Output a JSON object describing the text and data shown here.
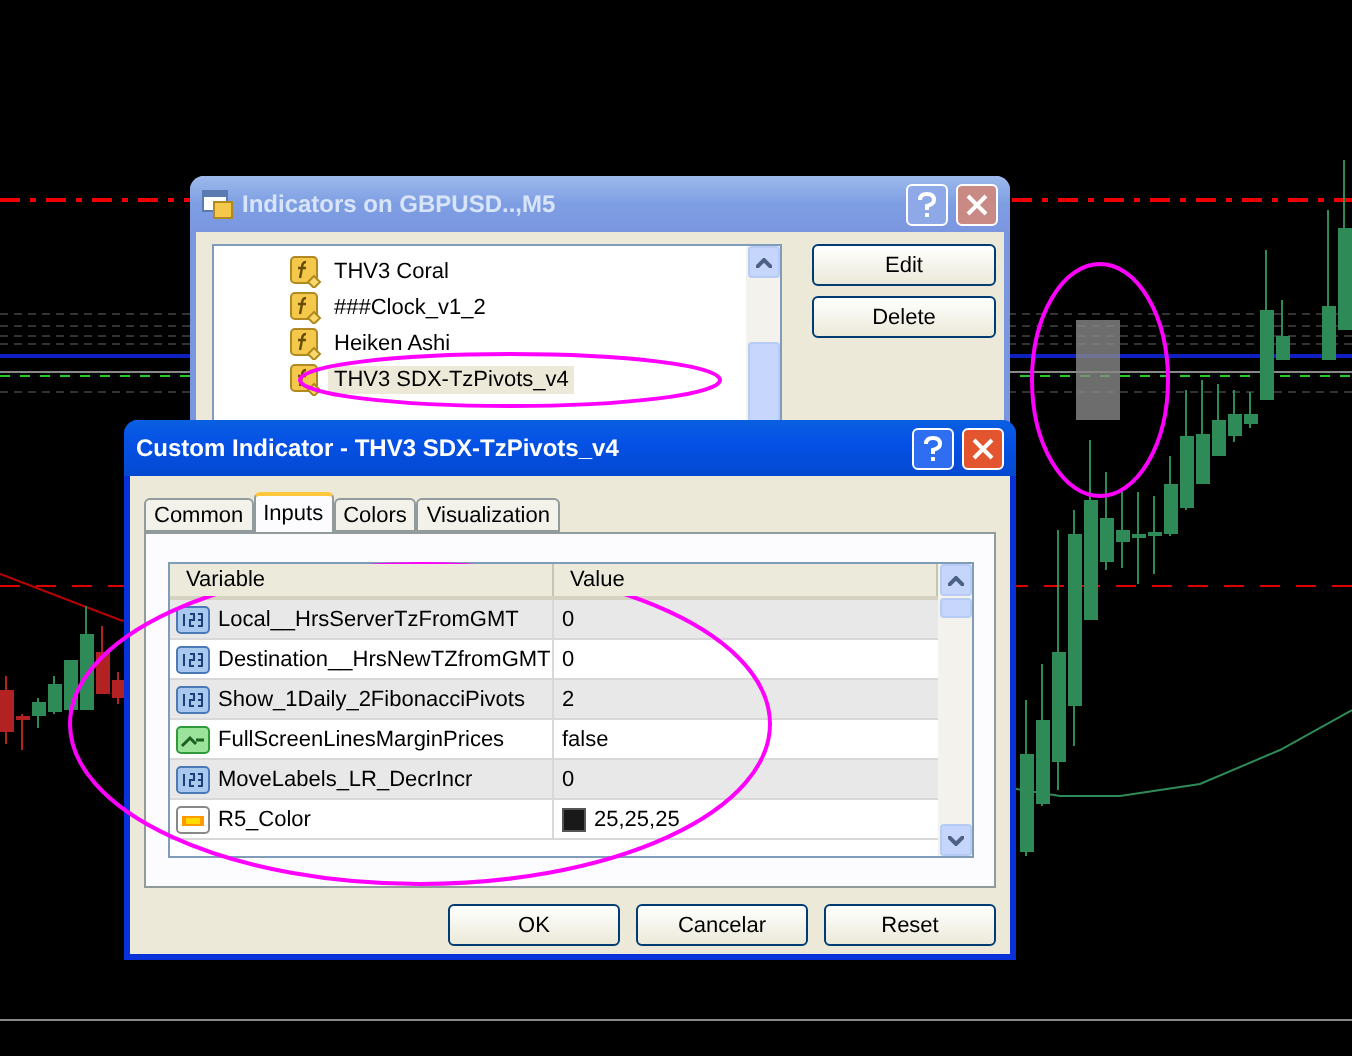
{
  "indicators_window": {
    "title": "Indicators on GBPUSD..,M5",
    "active": false,
    "tree": [
      {
        "label": "THV3 Coral",
        "selected": false
      },
      {
        "label": "###Clock_v1_2",
        "selected": false
      },
      {
        "label": "Heiken Ashi",
        "selected": false
      },
      {
        "label": "THV3 SDX-TzPivots_v4",
        "selected": true
      }
    ],
    "buttons": [
      "Edit",
      "Delete"
    ]
  },
  "custom_indicator_window": {
    "title": "Custom Indicator - THV3 SDX-TzPivots_v4",
    "active": true,
    "tabs": [
      {
        "label": "Common",
        "selected": false
      },
      {
        "label": "Inputs",
        "selected": true
      },
      {
        "label": "Colors",
        "selected": false
      },
      {
        "label": "Visualization",
        "selected": false
      }
    ],
    "table": {
      "columns": [
        "Variable",
        "Value"
      ],
      "rows": [
        {
          "kind": "number",
          "variable": "Local__HrsServerTzFromGMT",
          "value": "0"
        },
        {
          "kind": "number",
          "variable": "Destination__HrsNewTZfromGMT",
          "value": "0"
        },
        {
          "kind": "number",
          "variable": "Show_1Daily_2FibonacciPivots",
          "value": "2"
        },
        {
          "kind": "boolean",
          "variable": "FullScreenLinesMarginPrices",
          "value": "false"
        },
        {
          "kind": "number",
          "variable": "MoveLabels_LR_DecrIncr",
          "value": "0"
        },
        {
          "kind": "color",
          "variable": "R5_Color",
          "value": "25,25,25",
          "color": "#191919"
        }
      ]
    },
    "buttons": [
      "OK",
      "Cancelar",
      "Reset"
    ]
  }
}
